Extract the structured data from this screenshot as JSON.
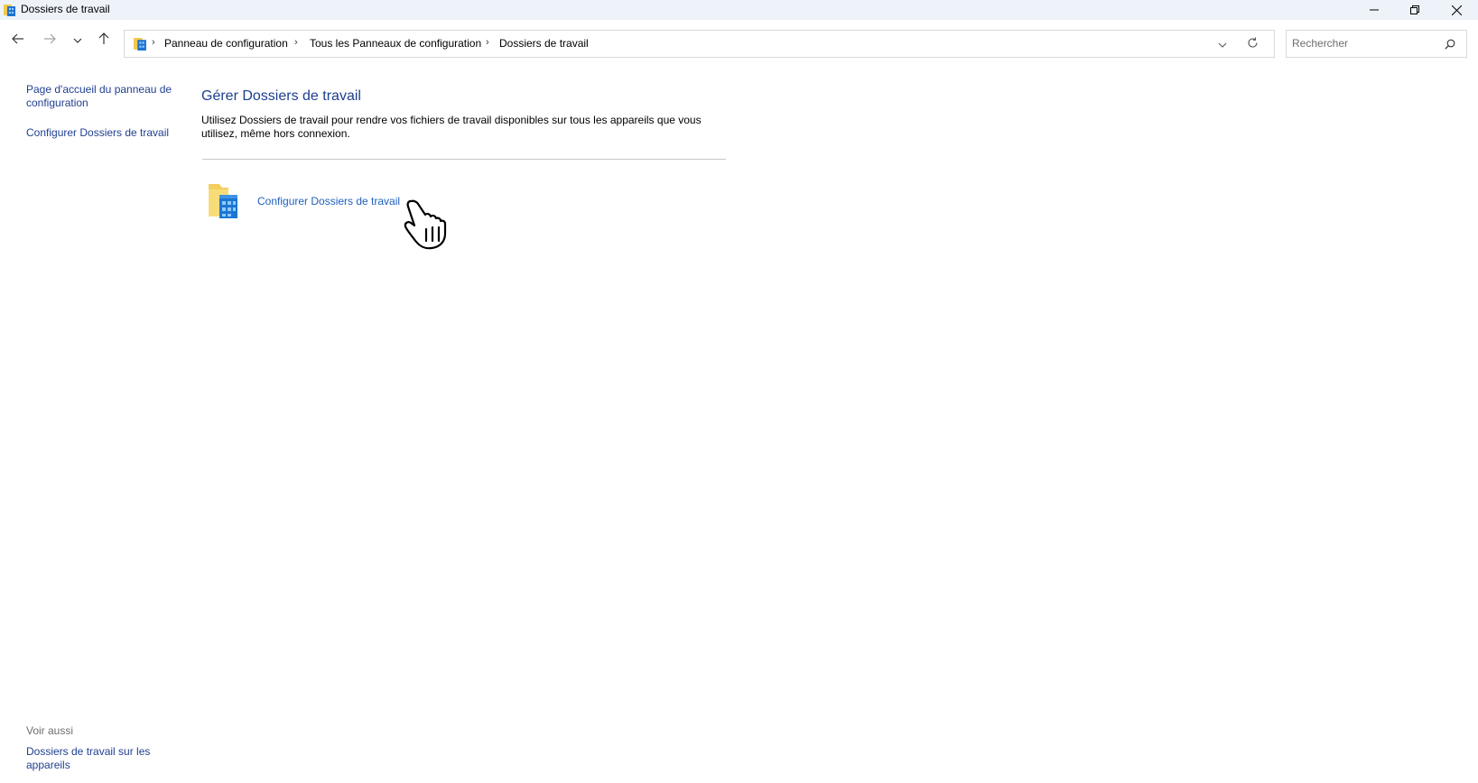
{
  "window": {
    "title": "Dossiers de travail",
    "controls": {
      "minimize_icon": "minimize-icon",
      "maximize_icon": "restore-icon",
      "close_icon": "close-icon"
    }
  },
  "nav": {
    "back_icon": "arrow-left-icon",
    "forward_icon": "arrow-right-icon",
    "recent_icon": "chevron-down-icon",
    "up_icon": "arrow-up-icon"
  },
  "address": {
    "breadcrumbs": [
      {
        "label": "Panneau de configuration"
      },
      {
        "label": "Tous les Panneaux de configuration"
      },
      {
        "label": "Dossiers de travail"
      }
    ],
    "dropdown_icon": "chevron-down-icon",
    "refresh_icon": "refresh-icon"
  },
  "search": {
    "placeholder": "Rechercher",
    "value": "",
    "icon": "search-icon"
  },
  "sidebar": {
    "links": [
      {
        "label": "Page d'accueil du panneau de configuration"
      },
      {
        "label": "Configurer Dossiers de travail"
      }
    ],
    "see_also_title": "Voir aussi",
    "see_also_links": [
      {
        "label": "Dossiers de travail sur les appareils"
      }
    ]
  },
  "main": {
    "title": "Gérer Dossiers de travail",
    "description": "Utilisez Dossiers de travail pour rendre vos fichiers de travail disponibles sur tous les appareils que vous utilisez, même hors connexion.",
    "task": {
      "label": "Configurer Dossiers de travail",
      "icon": "work-folders-icon"
    }
  },
  "colors": {
    "link": "#1f3f8f",
    "title": "#1e3f8f",
    "task_link": "#1f5fbf",
    "titlebar_bg": "#eef3fa"
  }
}
